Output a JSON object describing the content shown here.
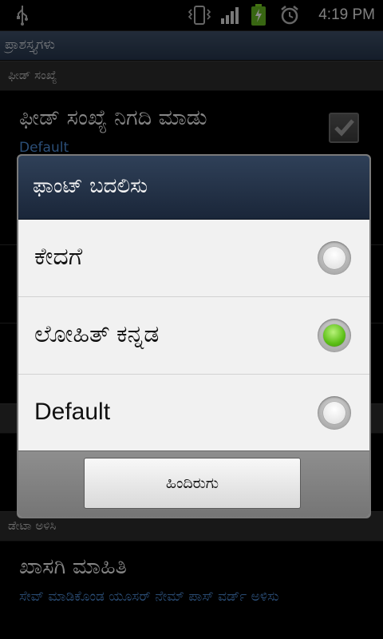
{
  "status_bar": {
    "time": "4:19 PM",
    "icons": [
      "usb-icon",
      "vibrate-icon",
      "signal-icon",
      "battery-charging-icon",
      "alarm-icon"
    ]
  },
  "window": {
    "title": "ಪ್ರಾಶಸ್ತ್ಯಗಳು"
  },
  "settings": {
    "feed_category": "ಫೀಡ್ ಸಂಖ್ಯೆ",
    "feed_item_title": "ಫೀಡ್ ಸಂಖ್ಯೆ ನಿಗದಿ ಮಾಡು",
    "feed_item_summary": "Default",
    "feed_item_checked": true,
    "delete_category": "ಡೇಟಾ ಅಳಿಸಿ",
    "private_item_title": "ಖಾಸಗಿ ಮಾಹಿತಿ",
    "private_item_summary": "ಸೇವ್ ಮಾಡಿಕೊಂಡ ಯೂಸರ್ ನೇಮ್ ಪಾಸ್ ವರ್ಡ್ ಅಳಿಸು"
  },
  "dialog": {
    "title": "ಫಾಂಟ್ ಬದಲಿಸು",
    "options": [
      {
        "label": "ಕೇದಗೆ",
        "selected": false
      },
      {
        "label": "ಲೋಹಿತ್ ಕನ್ನಡ",
        "selected": true
      },
      {
        "label": "Default",
        "selected": false
      }
    ],
    "cancel_label": "ಹಿಂದಿರುಗು"
  },
  "colors": {
    "accent_blue": "#4f8ed9",
    "header_dark": "#1a2639",
    "radio_selected": "#5cbf16"
  }
}
